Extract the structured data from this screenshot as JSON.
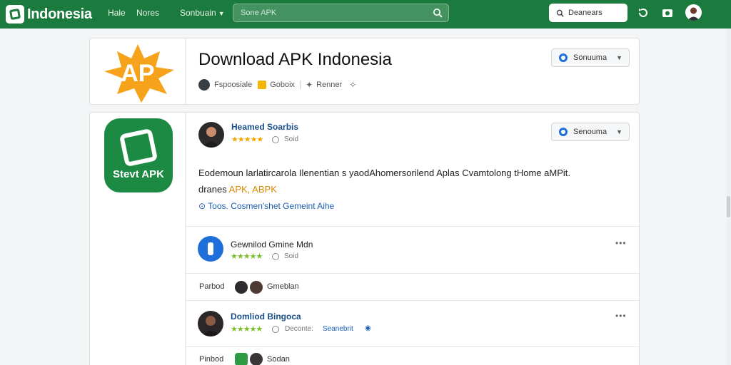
{
  "topbar": {
    "brand": "Indonesia",
    "nav": [
      "Hale",
      "Nores",
      "Sonbuain"
    ],
    "search_placeholder": "Sone APK",
    "action_button": "Deanears"
  },
  "header_card": {
    "logo_text": "AP",
    "title": "Download APK Indonesia",
    "meta_author": "Fspoosiale",
    "meta_badge": "Goboix",
    "meta_pin": "Renner",
    "dropdown": "Sonuuma"
  },
  "post_card": {
    "app_logo_caption": "Stevt APK",
    "author": "Heamed Soarbis",
    "count": "Soid",
    "dropdown": "Senouma",
    "body_line1": "Eodemoun larlatircarola Ilenentian s yaodAhomersorilend Aplas Cvamtolong tHome aMPit.",
    "body_line2_prefix": "dranes",
    "body_tag": "APK, ABPK",
    "link": "Toos. Cosmen'shet Gemeint Aihe"
  },
  "rows": [
    {
      "title": "Gewnilod Gmine Mdn",
      "count": "Soid",
      "foot_label": "Parbod",
      "foot_name": "Gmeblan"
    },
    {
      "author": "Domliod Bingoca",
      "meta": "Deconte:",
      "meta_link": "Seanebrit",
      "foot_label": "Pinbod",
      "foot_name": "Sodan"
    }
  ],
  "colors": {
    "brand_green": "#1b7a3e",
    "star": "#7bbf2a",
    "link": "#1a5fb4"
  }
}
